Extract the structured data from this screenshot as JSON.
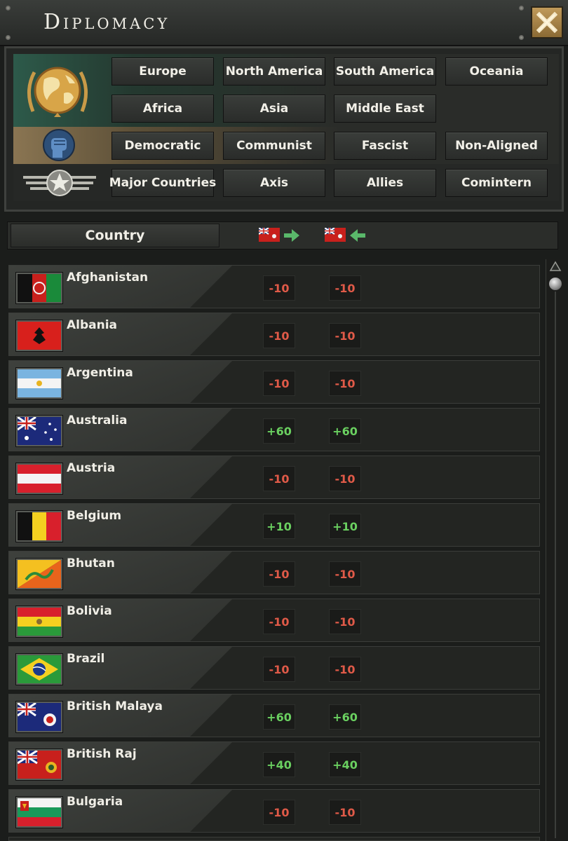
{
  "window": {
    "title": "Diplomacy"
  },
  "filters": {
    "regions": [
      "Europe",
      "North America",
      "South America",
      "Oceania",
      "Africa",
      "Asia",
      "Middle East"
    ],
    "ideologies": [
      "Democratic",
      "Communist",
      "Fascist",
      "Non-Aligned"
    ],
    "alliances": [
      "Major Countries",
      "Axis",
      "Allies",
      "Comintern"
    ]
  },
  "table": {
    "country_header": "Country",
    "rows": [
      {
        "name": "Afghanistan",
        "out": "-10",
        "in": "-10"
      },
      {
        "name": "Albania",
        "out": "-10",
        "in": "-10"
      },
      {
        "name": "Argentina",
        "out": "-10",
        "in": "-10"
      },
      {
        "name": "Australia",
        "out": "+60",
        "in": "+60"
      },
      {
        "name": "Austria",
        "out": "-10",
        "in": "-10"
      },
      {
        "name": "Belgium",
        "out": "+10",
        "in": "+10"
      },
      {
        "name": "Bhutan",
        "out": "-10",
        "in": "-10"
      },
      {
        "name": "Bolivia",
        "out": "-10",
        "in": "-10"
      },
      {
        "name": "Brazil",
        "out": "-10",
        "in": "-10"
      },
      {
        "name": "British Malaya",
        "out": "+60",
        "in": "+60"
      },
      {
        "name": "British Raj",
        "out": "+40",
        "in": "+40"
      },
      {
        "name": "Bulgaria",
        "out": "-10",
        "in": "-10"
      }
    ]
  },
  "colors": {
    "negative": "#e05a48",
    "positive": "#6ad060",
    "region_band": "#2d5a4a",
    "ideology_band": "#8a7552"
  }
}
